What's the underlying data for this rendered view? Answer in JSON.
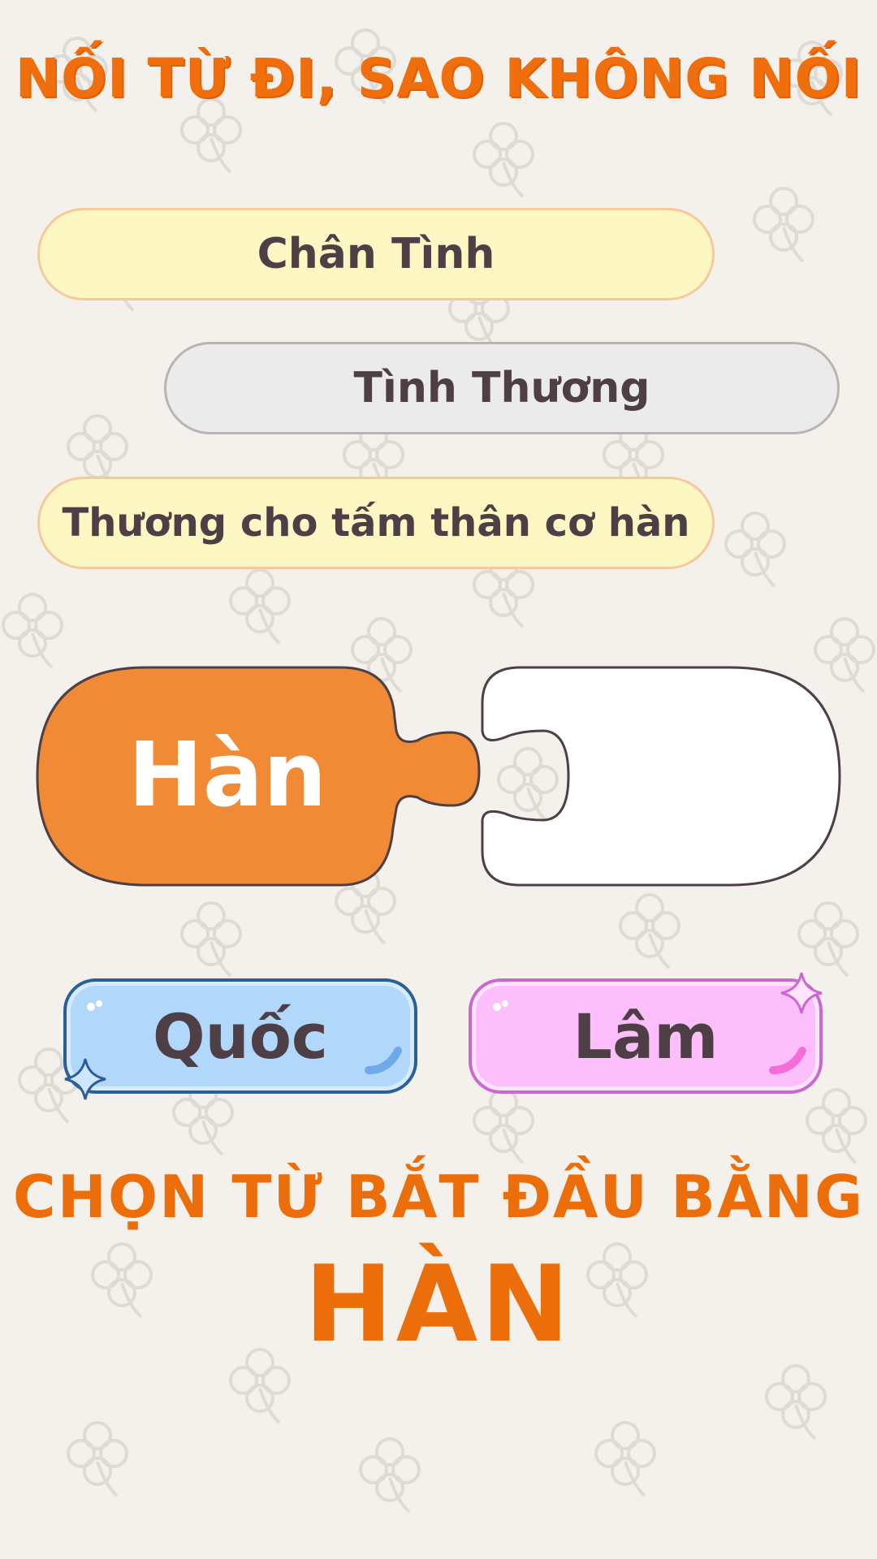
{
  "game": {
    "title": "NỐI TỪ ĐI, SAO KHÔNG NỐI",
    "history": [
      {
        "text": "Chân Tình",
        "color": "yellow"
      },
      {
        "text": "Tình Thương",
        "color": "gray"
      },
      {
        "text": "Thương cho tấm thân cơ hàn",
        "color": "yellow"
      }
    ],
    "current_word": "Hàn",
    "answer_slot": "",
    "choices": [
      {
        "label": "Quốc",
        "color": "#b1d7fb"
      },
      {
        "label": "Lâm",
        "color": "#fdbefc"
      }
    ],
    "prompt": "CHỌN TỪ BẮT ĐẦU BẰNG",
    "target_word": "HÀN"
  },
  "colors": {
    "accent_orange": "#f06e0c",
    "puzzle_orange": "#f08a34",
    "background": "#f4f1ec"
  },
  "icons": [
    "clover-pattern",
    "sparkle-icon",
    "shine-icon"
  ]
}
